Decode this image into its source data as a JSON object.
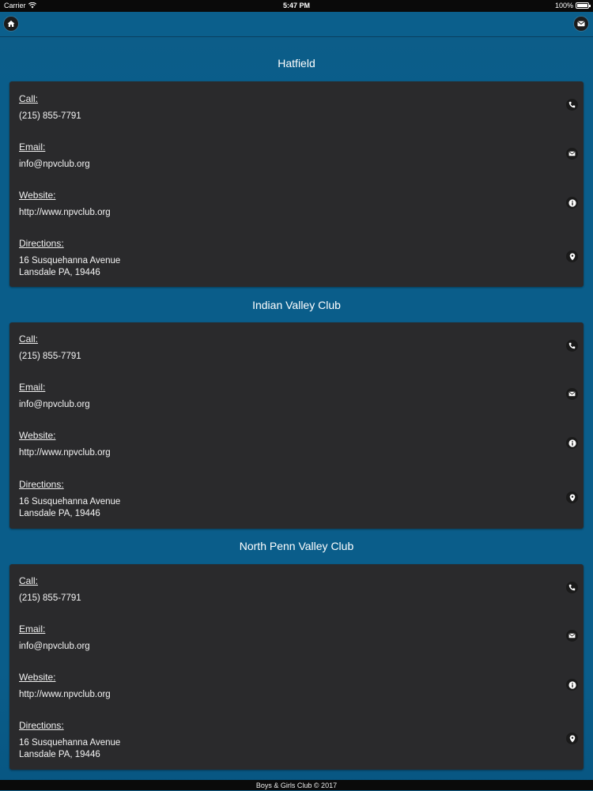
{
  "status_bar": {
    "carrier": "Carrier",
    "time": "5:47 PM",
    "battery": "100%"
  },
  "nav": {
    "home_icon": "home-icon",
    "mail_icon": "envelope-icon"
  },
  "clubs": [
    {
      "name": "Hatfield",
      "call_label": "Call:",
      "call_value": "(215) 855-7791",
      "email_label": "Email:",
      "email_value": "info@npvclub.org",
      "website_label": "Website:",
      "website_value": "http://www.npvclub.org",
      "directions_label": "Directions:",
      "address_line1": "16 Susquehanna Avenue",
      "address_line2": "Lansdale PA, 19446"
    },
    {
      "name": "Indian Valley Club",
      "call_label": "Call:",
      "call_value": "(215) 855-7791",
      "email_label": "Email:",
      "email_value": "info@npvclub.org",
      "website_label": "Website:",
      "website_value": "http://www.npvclub.org",
      "directions_label": "Directions:",
      "address_line1": "16 Susquehanna Avenue",
      "address_line2": "Lansdale PA, 19446"
    },
    {
      "name": "North Penn Valley Club",
      "call_label": "Call:",
      "call_value": "(215) 855-7791",
      "email_label": "Email:",
      "email_value": "info@npvclub.org",
      "website_label": "Website:",
      "website_value": "http://www.npvclub.org",
      "directions_label": "Directions:",
      "address_line1": "16 Susquehanna Avenue",
      "address_line2": "Lansdale PA, 19446"
    }
  ],
  "footer": {
    "text": "Boys & Girls Club © 2017"
  },
  "colors": {
    "background": "#0a5d8a",
    "card": "#2a2a2c",
    "bars": "#0a0a0a"
  }
}
